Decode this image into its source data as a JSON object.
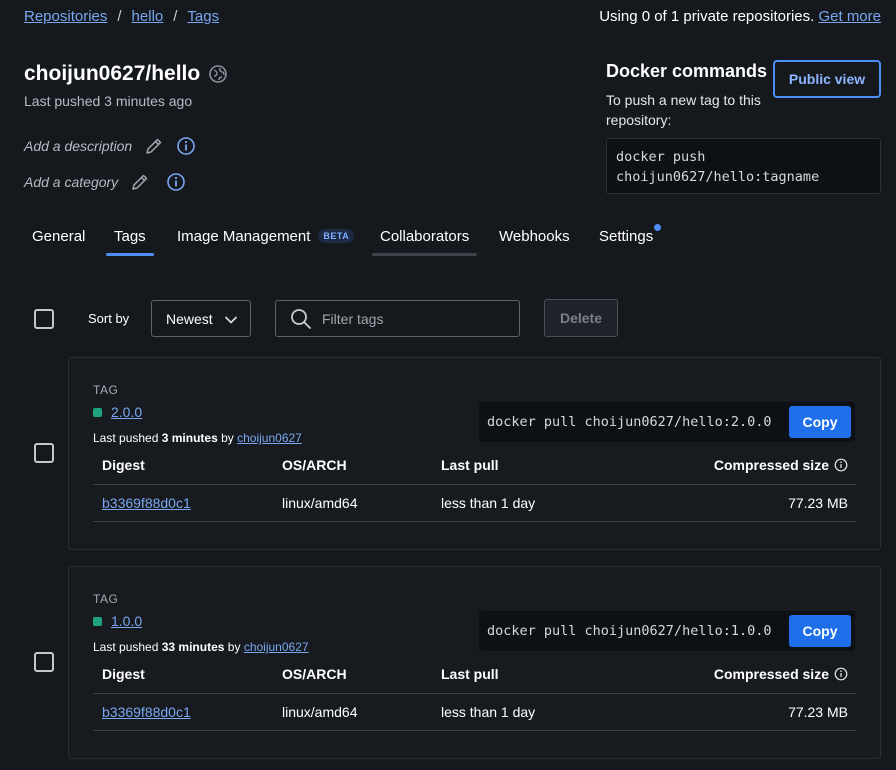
{
  "breadcrumb": {
    "items": [
      "Repositories",
      "hello",
      "Tags"
    ],
    "separator": "/"
  },
  "usage": {
    "text": "Using 0 of 1 private repositories.",
    "link": "Get more"
  },
  "repo": {
    "name": "choijun0627/hello",
    "last_pushed": "Last pushed 3 minutes ago",
    "add_description": "Add a description",
    "add_category": "Add a category"
  },
  "docker_commands": {
    "title": "Docker commands",
    "subtitle": "To push a new tag to this repository:",
    "public_view": "Public view",
    "push_command": "docker push choijun0627/hello:tagname"
  },
  "tabs": [
    {
      "label": "General"
    },
    {
      "label": "Tags",
      "active": true
    },
    {
      "label": "Image Management",
      "badge": "BETA"
    },
    {
      "label": "Collaborators"
    },
    {
      "label": "Webhooks"
    },
    {
      "label": "Settings"
    }
  ],
  "toolbar": {
    "sort_label": "Sort by",
    "sort_value": "Newest",
    "filter_placeholder": "Filter tags",
    "delete_label": "Delete"
  },
  "tag_table_headers": {
    "digest": "Digest",
    "os_arch": "OS/ARCH",
    "last_pull": "Last pull",
    "compressed_size": "Compressed size"
  },
  "tags": [
    {
      "section_label": "TAG",
      "name": "2.0.0",
      "pushed_prefix": "Last pushed",
      "pushed_time": "3 minutes",
      "pushed_by": "by",
      "pushed_user": "choijun0627",
      "pull_command": "docker pull choijun0627/hello:2.0.0",
      "copy_label": "Copy",
      "rows": [
        {
          "digest": "b3369f88d0c1",
          "os_arch": "linux/amd64",
          "last_pull": "less than 1 day",
          "size": "77.23 MB"
        }
      ]
    },
    {
      "section_label": "TAG",
      "name": "1.0.0",
      "pushed_prefix": "Last pushed",
      "pushed_time": "33 minutes",
      "pushed_by": "by",
      "pushed_user": "choijun0627",
      "pull_command": "docker pull choijun0627/hello:1.0.0",
      "copy_label": "Copy",
      "rows": [
        {
          "digest": "b3369f88d0c1",
          "os_arch": "linux/amd64",
          "last_pull": "less than 1 day",
          "size": "77.23 MB"
        }
      ]
    }
  ],
  "colors": {
    "background": "#15191e",
    "accent": "#1f6feb",
    "link": "#7aa7f0",
    "tag_status": "#1fa37e"
  }
}
